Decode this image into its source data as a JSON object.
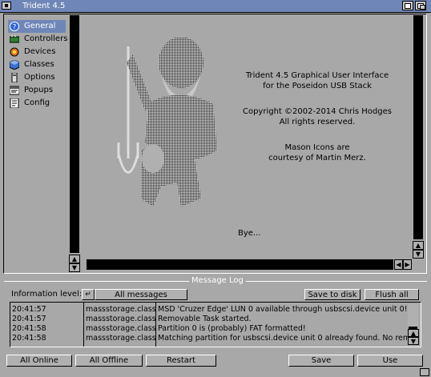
{
  "window": {
    "title": "Trident 4.5"
  },
  "sidebar": {
    "items": [
      {
        "label": "General",
        "icon": "question-icon",
        "selected": true
      },
      {
        "label": "Controllers",
        "icon": "controller-icon",
        "selected": false
      },
      {
        "label": "Devices",
        "icon": "devices-icon",
        "selected": false
      },
      {
        "label": "Classes",
        "icon": "classes-icon",
        "selected": false
      },
      {
        "label": "Options",
        "icon": "options-icon",
        "selected": false
      },
      {
        "label": "Popups",
        "icon": "popups-icon",
        "selected": false
      },
      {
        "label": "Config",
        "icon": "config-icon",
        "selected": false
      }
    ]
  },
  "about": {
    "line1": "Trident 4.5 Graphical User Interface",
    "line2": "for the Poseidon USB Stack",
    "line3": "Copyright ©2002-2014 Chris Hodges",
    "line4": "All rights reserved.",
    "line5": "Mason Icons are",
    "line6": "courtesy of Martin Merz.",
    "bye": "Bye..."
  },
  "message_log": {
    "title": "Message Log",
    "info_level_label": "Information level:",
    "info_level_value": "All messages",
    "save_to_disk": "Save to disk",
    "flush_all": "Flush all",
    "rows": [
      {
        "time": "20:41:57",
        "source": "massstorage.class",
        "message": "MSD 'Cruzer Edge' LUN 0 available through usbscsi.device unit 0!"
      },
      {
        "time": "20:41:57",
        "source": "massstorage.class",
        "message": "Removable Task started."
      },
      {
        "time": "20:41:58",
        "source": "massstorage.class",
        "message": "Partition 0 is (probably) FAT formatted!"
      },
      {
        "time": "20:41:58",
        "source": "massstorage.class",
        "message": "Matching partition for usbscsi.device unit 0 already found. No rem"
      }
    ]
  },
  "bottom_buttons": {
    "all_online": "All Online",
    "all_offline": "All Offline",
    "restart": "Restart",
    "save": "Save",
    "use": "Use"
  }
}
